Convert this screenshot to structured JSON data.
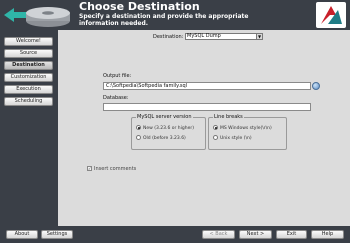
{
  "header": {
    "title": "Choose Destination",
    "subtitle": "Specify a destination and provide the appropriate information needed.",
    "logo_icon": "disk-icon",
    "brand_icon": "brand-logo-icon"
  },
  "sidebar": {
    "items": [
      {
        "label": "Welcome!"
      },
      {
        "label": "Source"
      },
      {
        "label": "Destination"
      },
      {
        "label": "Customization"
      },
      {
        "label": "Execution"
      },
      {
        "label": "Scheduling"
      }
    ],
    "active": "Destination"
  },
  "main": {
    "destination_label": "Destination:",
    "destination_value": "MySQL Dump",
    "output_file_label": "Output file:",
    "output_file_value": "C:\\Softpedia\\Softpedia family.sql",
    "database_label": "Database:",
    "database_value": "",
    "mysql_version": {
      "title": "MySQL server version",
      "options": [
        "New (3.23.6 or higher)",
        "Old (before 3.23.6)"
      ],
      "selected": "New (3.23.6 or higher)"
    },
    "line_breaks": {
      "title": "Line breaks",
      "options": [
        "MS Windows style(\\r\\n)",
        "Unix style (\\n)"
      ],
      "selected": "MS Windows style(\\r\\n)"
    },
    "insert_comments_label": "Insert comments",
    "insert_comments_checked": true
  },
  "footer": {
    "about": "About",
    "settings": "Settings",
    "back": "< Back",
    "next": "Next >",
    "exit": "Exit",
    "help": "Help"
  },
  "colors": {
    "frame": "#3a3f47",
    "panel": "#dcdcdc",
    "brand_red": "#c8202a",
    "brand_teal": "#1f7c86"
  }
}
